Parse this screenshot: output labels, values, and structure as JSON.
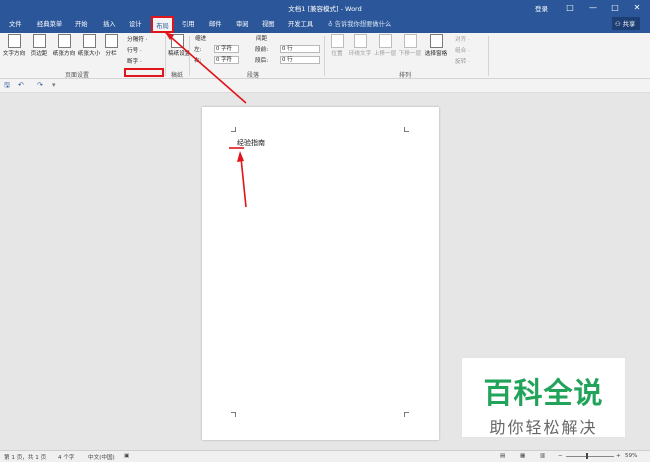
{
  "window": {
    "title": "文档1 [兼容模式] - Word",
    "login": "登录",
    "controls": [
      "□",
      "—",
      "□",
      "✕"
    ]
  },
  "tabs": [
    "文件",
    "经典菜单",
    "开始",
    "插入",
    "设计",
    "布局",
    "引用",
    "邮件",
    "审阅",
    "视图",
    "开发工具"
  ],
  "active_tab": "布局",
  "tell_me": "告诉我你想要做什么",
  "share": "共享",
  "ribbon": {
    "page_setup": {
      "buttons": [
        "文字方向",
        "页边距",
        "纸张方向",
        "纸张大小",
        "分栏"
      ],
      "small": [
        "分隔符 ·",
        "行号 ·",
        "断字 ·"
      ],
      "label": "页面设置"
    },
    "draft": {
      "button": "稿纸设置",
      "label": "稿纸"
    },
    "paragraph": {
      "indent_header": "缩进",
      "spacing_header": "间距",
      "left_label": "左:",
      "right_label": "右:",
      "before_label": "段前:",
      "after_label": "段后:",
      "left_value": "0 字符",
      "right_value": "0 字符",
      "before_value": "0 行",
      "after_value": "0 行",
      "label": "段落"
    },
    "arrange": {
      "buttons": [
        "位置",
        "环绕文字",
        "上移一层",
        "下移一层",
        "选择窗格"
      ],
      "small": [
        "对齐 ·",
        "组合 ·",
        "旋转 ·"
      ],
      "label": "排列"
    }
  },
  "qat": {
    "save": "🖫",
    "undo": "↶",
    "redo": "↷",
    "more": "▾"
  },
  "document": {
    "text": "经验指南"
  },
  "status": {
    "page": "第 1 页，共 1 页",
    "words": "4 个字",
    "language": "中文(中国)",
    "zoom": "59%"
  },
  "watermark": {
    "title": "百科全说",
    "subtitle": "助你轻松解决"
  },
  "colors": {
    "accent": "#2b579a",
    "highlight": "#e0151b",
    "watermark_green": "#22a35a"
  }
}
